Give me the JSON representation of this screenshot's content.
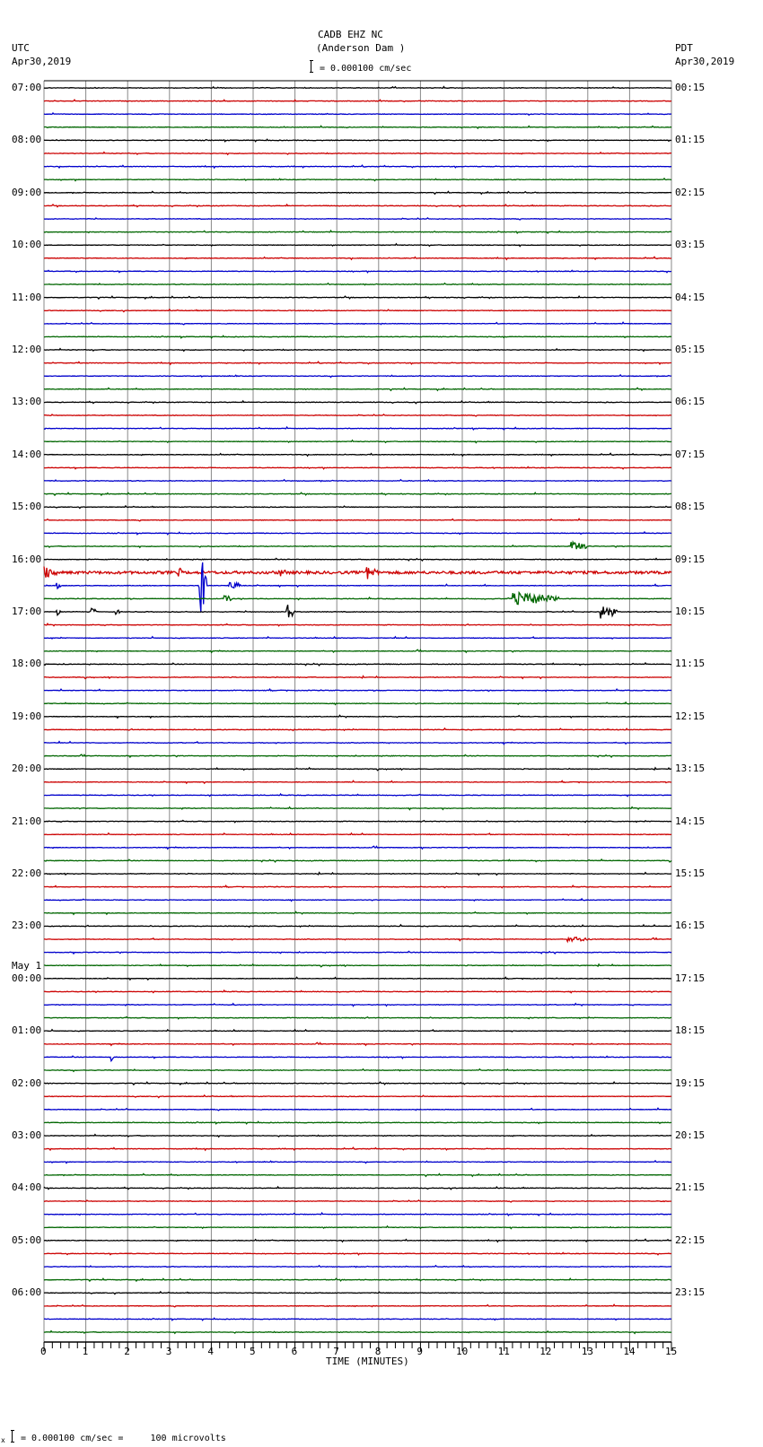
{
  "header": {
    "station": "CADB EHZ NC",
    "location": "(Anderson Dam )",
    "scale": "= 0.000100 cm/sec",
    "left_tz": "UTC",
    "left_date": "Apr30,2019",
    "right_tz": "PDT",
    "right_date": "Apr30,2019"
  },
  "footer": {
    "prefix": "x",
    "scale": "= 0.000100 cm/sec =     100 microvolts"
  },
  "chart_data": {
    "type": "line",
    "title": "CADB EHZ NC (Anderson Dam )",
    "xlabel": "TIME (MINUTES)",
    "xlim": [
      0,
      15
    ],
    "x_ticks": [
      "0",
      "1",
      "2",
      "3",
      "4",
      "5",
      "6",
      "7",
      "8",
      "9",
      "10",
      "11",
      "12",
      "13",
      "14",
      "15"
    ],
    "grid": true,
    "traces_per_hour": 4,
    "trace_count": 96,
    "trace_colors": [
      "#000000",
      "#cc0000",
      "#0000cc",
      "#006600"
    ],
    "left_labels": [
      {
        "row": 0,
        "text": "07:00"
      },
      {
        "row": 4,
        "text": "08:00"
      },
      {
        "row": 8,
        "text": "09:00"
      },
      {
        "row": 12,
        "text": "10:00"
      },
      {
        "row": 16,
        "text": "11:00"
      },
      {
        "row": 20,
        "text": "12:00"
      },
      {
        "row": 24,
        "text": "13:00"
      },
      {
        "row": 28,
        "text": "14:00"
      },
      {
        "row": 32,
        "text": "15:00"
      },
      {
        "row": 36,
        "text": "16:00"
      },
      {
        "row": 40,
        "text": "17:00"
      },
      {
        "row": 44,
        "text": "18:00"
      },
      {
        "row": 48,
        "text": "19:00"
      },
      {
        "row": 52,
        "text": "20:00"
      },
      {
        "row": 56,
        "text": "21:00"
      },
      {
        "row": 60,
        "text": "22:00"
      },
      {
        "row": 64,
        "text": "23:00"
      },
      {
        "row": 68,
        "text": "00:00",
        "date": "May 1"
      },
      {
        "row": 72,
        "text": "01:00"
      },
      {
        "row": 76,
        "text": "02:00"
      },
      {
        "row": 80,
        "text": "03:00"
      },
      {
        "row": 84,
        "text": "04:00"
      },
      {
        "row": 88,
        "text": "05:00"
      },
      {
        "row": 92,
        "text": "06:00"
      }
    ],
    "right_labels": [
      "00:15",
      "01:15",
      "02:15",
      "03:15",
      "04:15",
      "05:15",
      "06:15",
      "07:15",
      "08:15",
      "09:15",
      "10:15",
      "11:15",
      "12:15",
      "13:15",
      "14:15",
      "15:15",
      "16:15",
      "17:15",
      "18:15",
      "19:15",
      "20:15",
      "21:15",
      "22:15",
      "23:15"
    ],
    "events": [
      {
        "row": 35,
        "start": 12.6,
        "end": 13.0,
        "amp": 6
      },
      {
        "row": 37,
        "start": 0.0,
        "end": 0.3,
        "amp": 8
      },
      {
        "row": 37,
        "start": 3.2,
        "end": 3.3,
        "amp": 8
      },
      {
        "row": 37,
        "start": 5.6,
        "end": 5.8,
        "amp": 6
      },
      {
        "row": 37,
        "start": 7.7,
        "end": 8.0,
        "amp": 9
      },
      {
        "row": 38,
        "start": 3.7,
        "end": 3.9,
        "amp": 40
      },
      {
        "row": 38,
        "start": 4.4,
        "end": 4.7,
        "amp": 6
      },
      {
        "row": 38,
        "start": 0.3,
        "end": 0.4,
        "amp": 4
      },
      {
        "row": 39,
        "start": 11.2,
        "end": 12.3,
        "amp": 8
      },
      {
        "row": 39,
        "start": 4.3,
        "end": 4.5,
        "amp": 5
      },
      {
        "row": 40,
        "start": 0.3,
        "end": 0.4,
        "amp": 5
      },
      {
        "row": 40,
        "start": 1.1,
        "end": 1.3,
        "amp": 5
      },
      {
        "row": 40,
        "start": 1.7,
        "end": 1.8,
        "amp": 5
      },
      {
        "row": 40,
        "start": 5.8,
        "end": 6.0,
        "amp": 9
      },
      {
        "row": 40,
        "start": 13.3,
        "end": 13.7,
        "amp": 9
      },
      {
        "row": 65,
        "start": 12.5,
        "end": 13.1,
        "amp": 3
      },
      {
        "row": 74,
        "start": 1.6,
        "end": 1.65,
        "amp": 5
      }
    ],
    "noisy_rows": [
      37
    ]
  }
}
